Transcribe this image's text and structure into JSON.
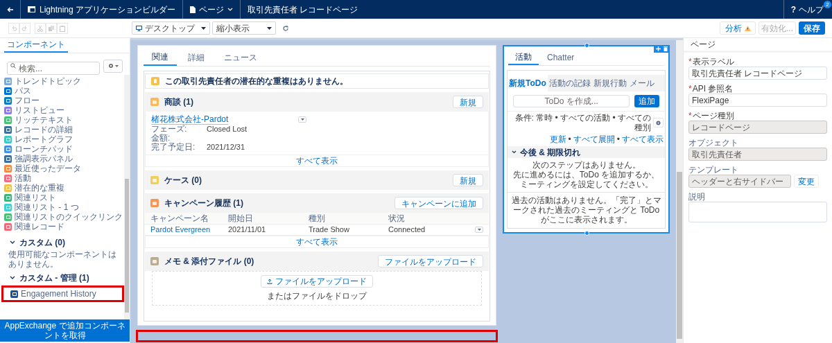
{
  "top_bar": {
    "app_title": "Lightning アプリケーションビルダー",
    "page_menu": "ページ",
    "record_page_title": "取引先責任者 レコードページ",
    "help": {
      "icon": "?",
      "label": "ヘルプ",
      "badge": "2"
    }
  },
  "toolbar": {
    "device": "デスクトップ",
    "zoom": "縮小表示",
    "analyze": "分析",
    "activate": {
      "label": "有効化...",
      "disabled": true
    },
    "save": "保存"
  },
  "components_panel": {
    "tab": "コンポーネント",
    "search_placeholder": "検索...",
    "items": [
      {
        "label": "トレンドトピック",
        "color": "#7fa7d8"
      },
      {
        "label": "パス",
        "color": "#0070d2"
      },
      {
        "label": "フロー",
        "color": "#0b7ec2"
      },
      {
        "label": "リストビュー",
        "color": "#8b7ce8"
      },
      {
        "label": "リッチテキスト",
        "color": "#4bc076"
      },
      {
        "label": "レコードの詳細",
        "color": "#3f6fa0"
      },
      {
        "label": "レポートグラフ",
        "color": "#3fc9c0"
      },
      {
        "label": "ローンチパッド",
        "color": "#4a90e2"
      },
      {
        "label": "強調表示パネル",
        "color": "#3f6fa0"
      },
      {
        "label": "最近使ったデータ",
        "color": "#f28b45"
      },
      {
        "label": "活動",
        "color": "#f06b7b"
      },
      {
        "label": "潜在的な重複",
        "color": "#f4c24a"
      },
      {
        "label": "関連リスト",
        "color": "#3bb57c"
      },
      {
        "label": "関連リスト - 1 つ",
        "color": "#3fd0cf"
      },
      {
        "label": "関連リストのクイックリンク",
        "color": "#4bc076"
      },
      {
        "label": "関連レコード",
        "color": "#f06b7b"
      }
    ],
    "sections": [
      {
        "title": "カスタム (0)",
        "expanded": true,
        "empty_text": "使用可能なコンポーネントはありません。"
      },
      {
        "title": "カスタム - 管理 (1)",
        "expanded": true,
        "items": [
          {
            "label": "Engagement History",
            "color": "#1b5297",
            "highlighted": true
          }
        ]
      }
    ],
    "appexchange_button": "AppExchange で追加コンポーネントを取得"
  },
  "canvas": {
    "main": {
      "tabs": [
        {
          "label": "関連",
          "selected": true
        },
        {
          "label": "詳細",
          "selected": false
        },
        {
          "label": "ニュース",
          "selected": false
        }
      ],
      "duplicates_message": "この取引先責任者の潜在的な重複はありません。",
      "cards": [
        {
          "kind": "records",
          "title": "商談 (1)",
          "color": "#fcb95b",
          "button": "新規",
          "record_link": "楮花株式会社-Pardot",
          "fields": [
            {
              "label": "フェーズ:",
              "value": "Closed Lost"
            },
            {
              "label": "金額:"
            },
            {
              "label": "完了予定日:",
              "value": "2021/12/31"
            }
          ],
          "footer_link": "すべて表示"
        },
        {
          "kind": "empty",
          "title": "ケース (0)",
          "color": "#f2cf5b",
          "button": "新規"
        },
        {
          "kind": "table",
          "title": "キャンペーン履歴 (1)",
          "color": "#f49756",
          "button": "キャンペーンに追加",
          "columns": [
            "キャンペーン名",
            "開始日",
            "種別",
            "状況"
          ],
          "rows": [
            [
              "Pardot Evergreen",
              "2021/11/01",
              "Trade Show",
              "Connected"
            ]
          ],
          "footer_link": "すべて表示"
        },
        {
          "kind": "files",
          "title": "メモ & 添付ファイル (0)",
          "color": "#baac93",
          "button": "ファイルをアップロード",
          "upload_button": "ファイルをアップロード",
          "drop_text": "またはファイルをドロップ"
        }
      ]
    },
    "sidebar": {
      "selected": true,
      "tabs": [
        {
          "label": "活動",
          "selected": true
        },
        {
          "label": "Chatter",
          "selected": false
        }
      ],
      "subtabs": [
        {
          "label": "新規ToDo",
          "selected": true
        },
        {
          "label": "活動の記録",
          "selected": false
        },
        {
          "label": "新規行動",
          "selected": false
        },
        {
          "label": "メール",
          "selected": false
        }
      ],
      "task_placeholder": "ToDo を作成...",
      "add_button": "追加",
      "filter": "条件: 常時 • すべての活動 • すべての種別",
      "links": [
        "更新",
        "すべて展開",
        "すべて表示"
      ],
      "link_separator": "•",
      "section": {
        "title": "今後 & 期限切れ",
        "expanded": true
      },
      "next_steps": [
        "次のステップはありません。",
        "先に進めるには、ToDo を追加するか、ミーティングを設定してください。"
      ],
      "past": "過去の活動はありません。「完了」とマークされた過去のミーティングと ToDo がここに表示されます。"
    },
    "drop_zone": {
      "highlighted": true
    }
  },
  "properties": {
    "header": "ページ",
    "required_mark": "*",
    "fields": [
      {
        "kind": "input",
        "label": "表示ラベル",
        "required": true,
        "disabled": false,
        "value": "取引先責任者 レコードページ"
      },
      {
        "kind": "input",
        "label": "API 参照名",
        "required": true,
        "disabled": false,
        "value": "FlexiPage"
      },
      {
        "kind": "input",
        "label": "ページ種別",
        "required": true,
        "disabled": true,
        "value": "レコードページ"
      },
      {
        "kind": "input",
        "label": "オブジェクト",
        "required": false,
        "disabled": true,
        "value": "取引先責任者"
      },
      {
        "kind": "input_button",
        "label": "テンプレート",
        "required": false,
        "disabled": true,
        "value": "ヘッダーと右サイドバー",
        "button": "変更"
      },
      {
        "kind": "textarea",
        "label": "説明",
        "required": false,
        "disabled": false
      }
    ]
  }
}
